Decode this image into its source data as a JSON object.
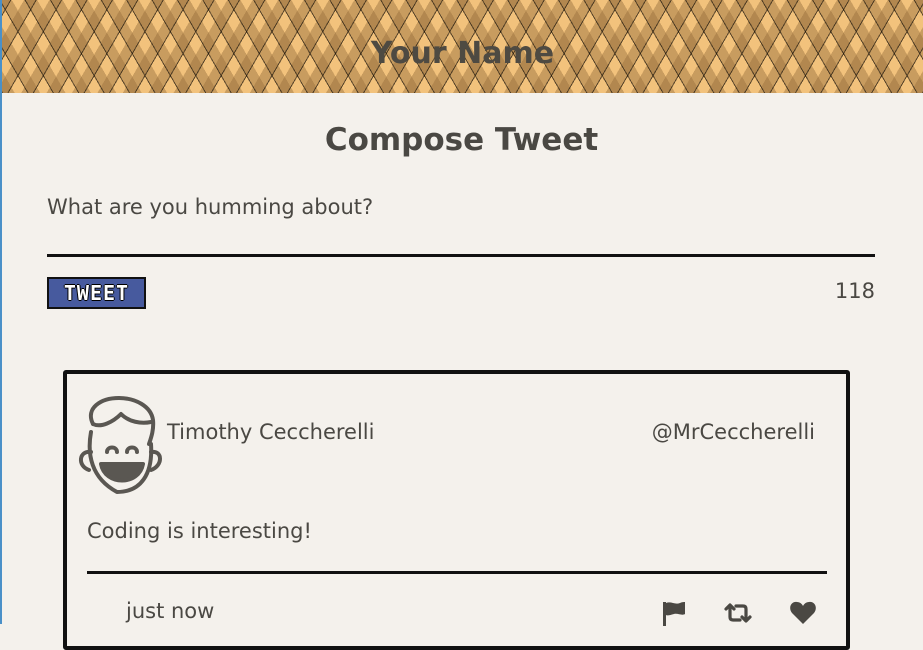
{
  "header": {
    "site_name": "Your Name"
  },
  "compose": {
    "title": "Compose Tweet",
    "placeholder": "What are you humming about?",
    "button_label": "TWEET",
    "char_count": "118"
  },
  "tweet": {
    "author_name": "Timothy Ceccherelli",
    "author_handle": "@MrCeccherelli",
    "text": "Coding is interesting!",
    "timestamp": "just now",
    "actions": [
      "flag-icon",
      "retweet-icon",
      "heart-icon"
    ]
  },
  "colors": {
    "background": "#f4f1ec",
    "header_pattern_base": "#f2c27c",
    "text": "#4a4843",
    "tweet_button": "#475a9e"
  }
}
